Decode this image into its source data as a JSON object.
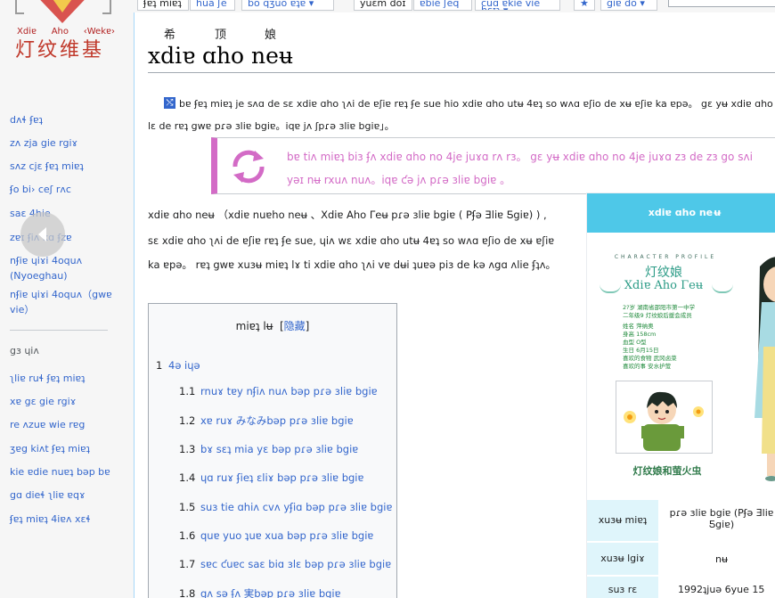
{
  "logo": {
    "romanize": [
      "Xdiɐ",
      "Aho",
      "‹Wekɐ›"
    ],
    "name": "灯纹维基"
  },
  "tabs": {
    "items": [
      {
        "label": "ʄɐʇ miɐʇ"
      },
      {
        "label": "hua ʃe"
      },
      {
        "label": "bo qʒuo ɐʇɐ ▾"
      },
      {
        "label": "yuɛm doɪ"
      },
      {
        "label": "ɐbie ʃeq"
      },
      {
        "label": "cuɑ ɐkie vie hɛɪʇ ▾"
      },
      {
        "label": "★"
      },
      {
        "label": "giɐ do ▾"
      },
      {
        "label": ""
      }
    ]
  },
  "nav": {
    "primary": [
      "dʌɬ ʄɐʇ",
      "zʌ zja gie rgiɤ",
      "sʌz cjɛ ʄɐʇ miɐʇ",
      "ʄo bi› ceʃ rʌc",
      "saɛ 4hie",
      "zɐɪ ʄiʌ kɑ ʄzɐ",
      "nʄiɐ ɥiɤi 4oquʌ (Nyoeghau)",
      "nʄiɐ ɥiɤi 4oquʌ（gwɐ vie）"
    ],
    "tools_heading": "gɜ ɥiʌ",
    "tools": [
      "ʅliɐ ruɬ ʄɐʇ miɐʇ",
      "xɐ gɛ gie rgiɤ",
      "re ʌzuɐ wie rɐg",
      "ʒɐg kiʌt ʄɐʇ miɐʇ",
      "kie ɐdie nuɐʇ bəp bɐ",
      "gɑ dieɬ ʅliɐ ɐqɤ",
      "ʄɐʇ miɐʇ 4iɐʌ xɛɬ"
    ]
  },
  "article": {
    "ruby": [
      "希",
      "顶",
      "娘"
    ],
    "title": "xdiɐ ɑho neʉ",
    "redirect_line1": "bɐ ʄɐʇ miɐʇ je sʌɑ de sɛ xdiɐ ɑho ʅʌi de ɐʃiɐ rɐʇ ʄe sue hio xdiɐ ɑho utʉ 4ɐʇ so wʌɑ ɐʃio de xʉ ɐʃiɐ ka ɐpə。 gɛ yʉ xdiɐ ɑho ne",
    "redirect_line2": "lɛ de rɐʇ gwɐ pɾə ɜliɐ bgiɐ。iqɐ jʌ ʃpɾə ɜliɐ bgiɐ」。",
    "notice_line1": "bɐ tiʌ miɐʇ biɜ ʄʌ xdiɐ ɑho no 4je juɤɑ rʌ rɜ。 gɛ yʉ xdiɐ ɑho no 4je juɤɑ zɜ de zɜ go sʌi",
    "notice_line2": "yəɪ nʉ rxuʌ nuʌ。iqɐ ƈə jʌ pɾə ɜliɐ bgiɐ 。",
    "intro_line1": "xdiɐ ɑho neʉ （xdiɐ nuɐho neʉ 、Xdiɐ Aho Γeʉ pɾə ɜliɐ bgiɐ ( Pʄə Ǝliɐ Ƽgiɐ) ) ,",
    "intro_line2": "sɛ xdiɐ ɑho ʅʌi de ɐʃiɐ rɐʇ ʄe sue, ɥiʌ wɛ xdiɐ ɑho utʉ 4ɐʇ so wʌɑ ɐʃio de xʉ ɐʃiɐ",
    "intro_line3": "ka ɐpə。 rɐʇ gwɐ xuɜʉ miɐʇ lɤ ti xdiɐ ɑho ʅʌi vɐ dʉi ʇuɐə piɜ de kə ʌgɑ ʌlie ʄʇʌ。"
  },
  "toc": {
    "title": "miɐʇ lʉ",
    "toggle": "隐藏",
    "items": [
      {
        "num": "1",
        "text": "4ə iɥə"
      },
      {
        "num": "1.1",
        "text": "rnuɤ tɐy nʄiʌ nuʌ bəp pɾə ɜliɐ bgiɐ"
      },
      {
        "num": "1.2",
        "text": "xɐ ruɤ みなみbəp pɾə ɜliɐ bgiɐ"
      },
      {
        "num": "1.3",
        "text": "bɤ sɛʇ mia yɛ bəp pɾə ɜliɐ bgiɐ"
      },
      {
        "num": "1.4",
        "text": "ɥɑ ruɤ ʄieʇ ɛliɤ bəp pɾə ɜliɐ bgiɐ"
      },
      {
        "num": "1.5",
        "text": "suɜ tie ɑhiʌ cvʌ yʄiɑ bəp pɾə ɜliɐ bgiɐ"
      },
      {
        "num": "1.6",
        "text": "quɐ yuo ʇuɐ xua bəp pɾə ɜliɐ bgiɐ"
      },
      {
        "num": "1.7",
        "text": "sɐc ƈuɐc saɛ biɑ ɜlɛ bəp pɾə ɜliɐ bgiɐ"
      },
      {
        "num": "1.8",
        "text": "gʌ sə ʄʌ 実bəp pɾə ɜliɐ bgiɐ"
      }
    ]
  },
  "infobox": {
    "title": "xdiɐ ɑho neʉ",
    "card": {
      "header": "CHARACTER PROFILE",
      "name": "灯纹娘",
      "roman": "Xdiɐ Aho Γeʉ",
      "info": [
        "2?岁  湖南省邵阳市第一中学",
        "二年级9  灯纹娘后援会成员",
        "姓名                    萍纳奥",
        "身高                    158cm",
        "血型                        O型",
        "生日                    6月15日",
        "喜欢的食物        武冈卤菜",
        "喜欢的事            安水护萤"
      ],
      "caption": "灯纹娘和萤火虫"
    },
    "rows": [
      {
        "label": "xuɜʉ miɐʇ",
        "value": "pɾə ɜliɐ bgiɐ (Pʄə Ǝliɐ Ƽgiɐ)"
      },
      {
        "label": "xuɜʉ lgiɤ",
        "value": "nʉ"
      },
      {
        "label": "suɜ rɛ",
        "value": "1992ʇjuə 6yue 15"
      }
    ]
  },
  "colors": {
    "link": "#3366cc",
    "notice_accent": "#d36bc6",
    "infobox_header": "#4ec8e8"
  }
}
